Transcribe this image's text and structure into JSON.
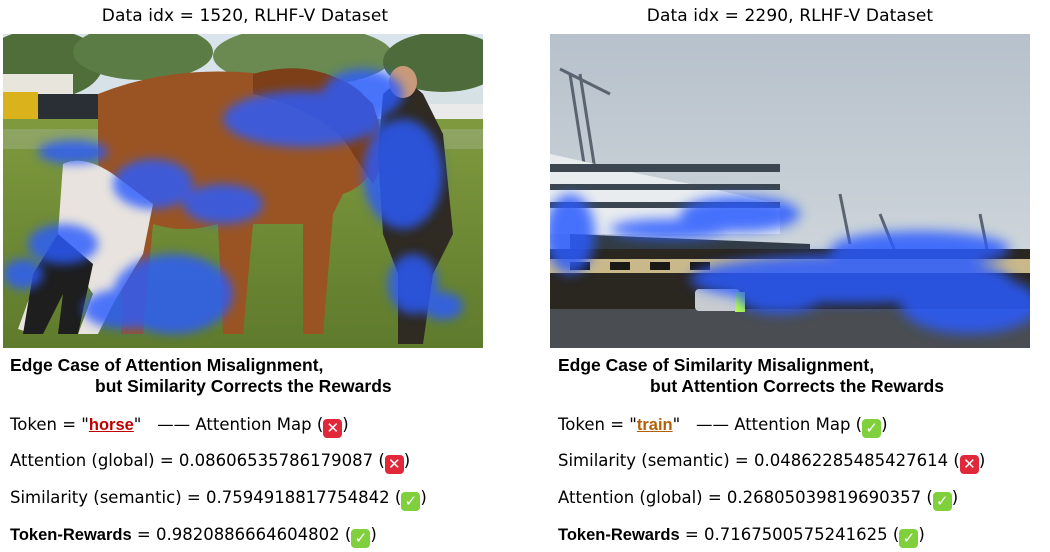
{
  "left": {
    "title": "Data idx = 1520, RLHF-V Dataset",
    "case_title_line1": "Edge Case of Attention Misalignment,",
    "case_title_line2": "but Similarity Corrects the Rewards",
    "token_prefix": "Token = \"",
    "token": "horse",
    "token_suffix": "\"",
    "attention_map_label": "—— Attention Map (",
    "row2_label": "Attention (global)  = 0.08606535786179087 (",
    "row3_label": "Similarity (semantic) = 0.7594918817754842 (",
    "rewards_label": "Token-Rewards",
    "rewards_value": " = 0.9820886664604802 (",
    "close_paren": ")"
  },
  "right": {
    "title": "Data idx = 2290, RLHF-V Dataset",
    "case_title_line1": "Edge Case of  Similarity Misalignment,",
    "case_title_line2": "but Attention Corrects the Rewards",
    "token_prefix": "Token = \"",
    "token": "train",
    "token_suffix": "\"",
    "attention_map_label": "—— Attention Map (",
    "row2_label": "Similarity (semantic) = 0.04862285485427614 (",
    "row3_label": "Attention (global) = 0.26805039819690357 (",
    "rewards_label": "Token-Rewards",
    "rewards_value": " = 0.7167500575241625 (",
    "close_paren": ")"
  },
  "colors": {
    "cross": "#e0283a",
    "check": "#7fd03c",
    "attention_overlay": "#2a5cff"
  }
}
